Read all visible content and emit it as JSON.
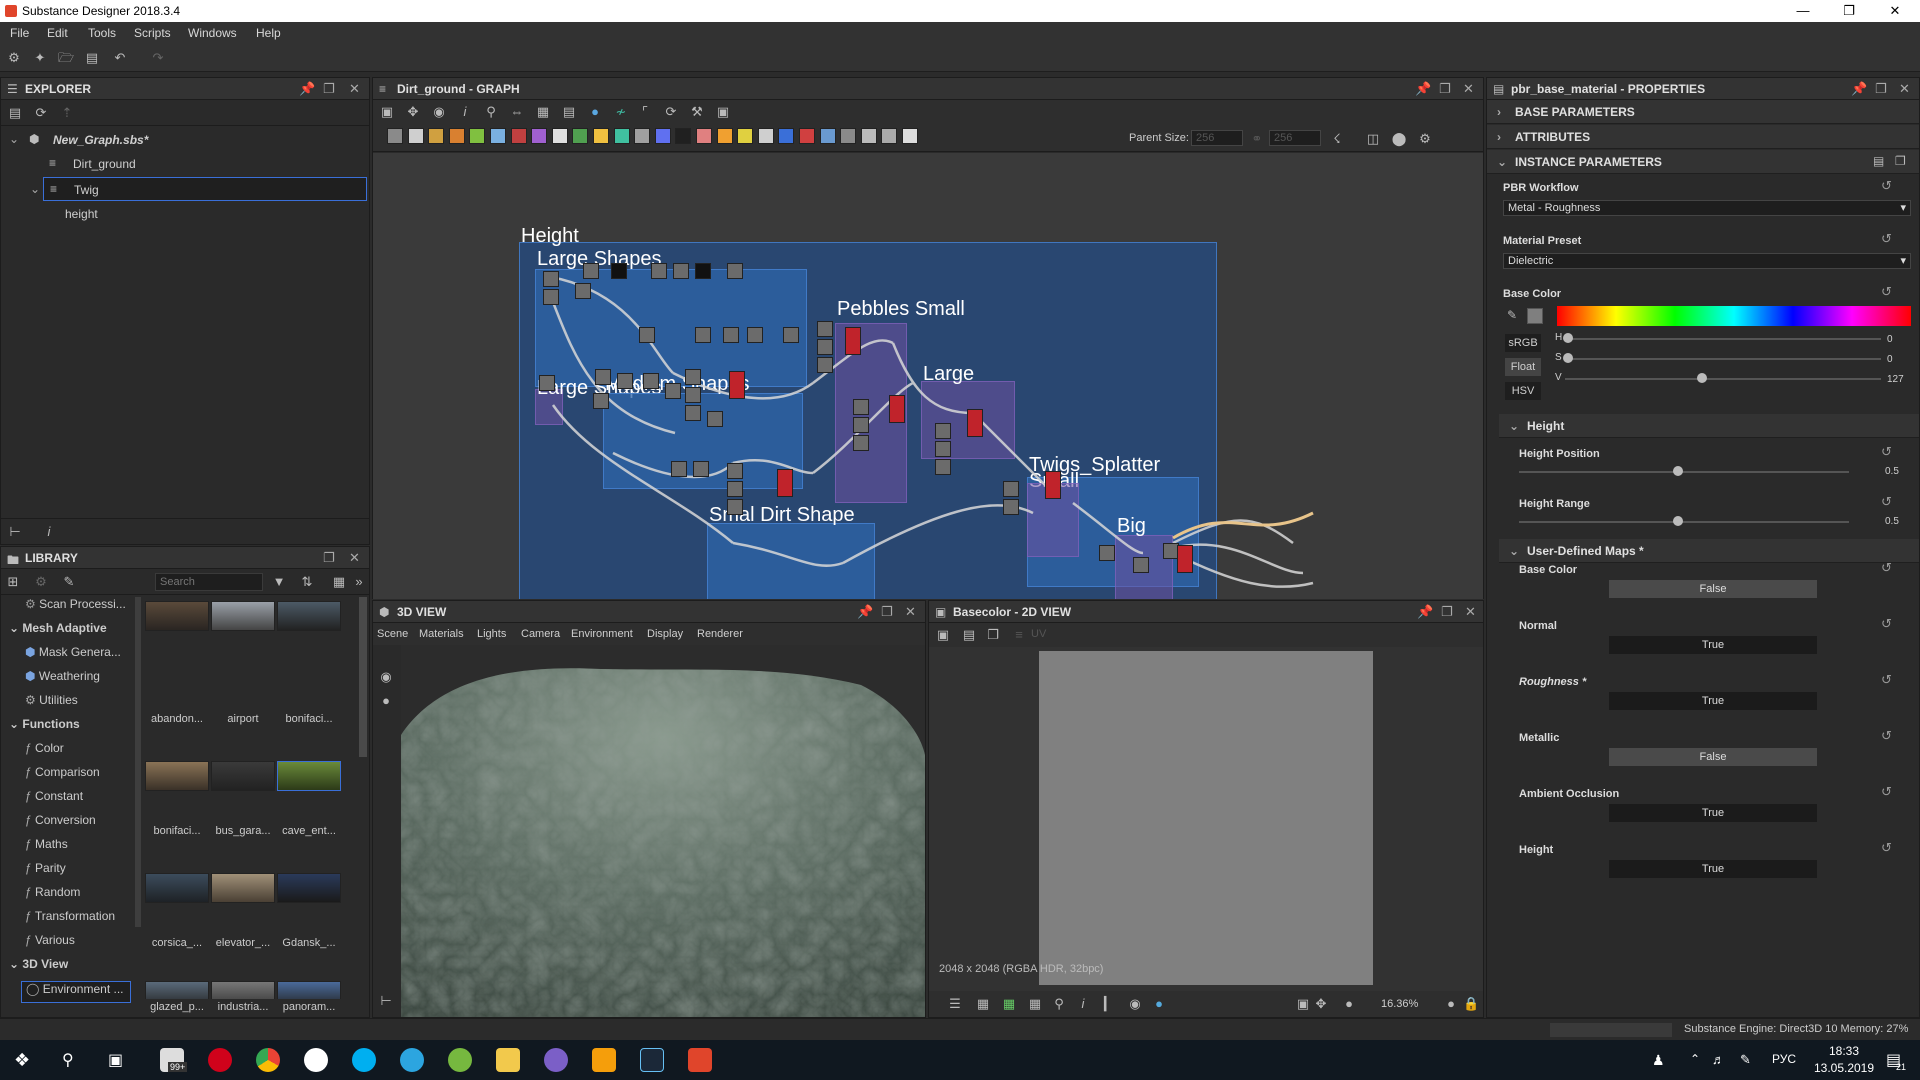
{
  "window": {
    "title": "Substance Designer 2018.3.4"
  },
  "menu": [
    "File",
    "Edit",
    "Tools",
    "Scripts",
    "Windows",
    "Help"
  ],
  "explorer": {
    "title": "EXPLORER",
    "package": "New_Graph.sbs*",
    "items": [
      "Dirt_ground",
      "Twig",
      "height"
    ]
  },
  "library": {
    "title": "LIBRARY",
    "search_placeholder": "Search",
    "categories": [
      "Scan Processi...",
      "Mesh Adaptive",
      "Mask Genera...",
      "Weathering",
      "Utilities",
      "Functions",
      "Color",
      "Comparison",
      "Constant",
      "Conversion",
      "Maths",
      "Parity",
      "Random",
      "Transformation",
      "Various",
      "3D View",
      "Environment ..."
    ],
    "thumbs": [
      "abandon...",
      "airport",
      "bonifaci...",
      "bonifaci...",
      "bus_gara...",
      "cave_ent...",
      "corsica_...",
      "elevator_...",
      "Gdansk_...",
      "glazed_p...",
      "industria...",
      "panoram..."
    ]
  },
  "graph": {
    "title": "Dirt_ground - GRAPH",
    "parent_size_label": "Parent Size:",
    "parent_size": "256",
    "size2": "256",
    "frames": [
      "Height",
      "Large Shapes",
      "Large Shapes",
      "Medium Shapes",
      "Pebbles Small",
      "Large",
      "Smal Dirt Shape",
      "Twigs_Splatter Small",
      "Big"
    ]
  },
  "view3d": {
    "title": "3D VIEW",
    "menu": [
      "Scene",
      "Materials",
      "Lights",
      "Camera",
      "Environment",
      "Display",
      "Renderer"
    ]
  },
  "view2d": {
    "title": "Basecolor - 2D VIEW",
    "uv": "UV",
    "info": "2048 x 2048 (RGBA HDR, 32bpc)",
    "zoom": "16.36%"
  },
  "properties": {
    "title": "pbr_base_material - PROPERTIES",
    "sections": [
      "BASE PARAMETERS",
      "ATTRIBUTES",
      "INSTANCE PARAMETERS"
    ],
    "pbr_workflow_label": "PBR Workflow",
    "pbr_workflow": "Metal - Roughness",
    "material_preset_label": "Material Preset",
    "material_preset": "Dielectric",
    "base_color_label": "Base Color",
    "color_modes": [
      "sRGB",
      "Float",
      "HSV"
    ],
    "hsv": [
      {
        "k": "H",
        "v": "0"
      },
      {
        "k": "S",
        "v": "0"
      },
      {
        "k": "V",
        "v": "127"
      }
    ],
    "height_group": "Height",
    "height_position_label": "Height Position",
    "height_position": "0.5",
    "height_range_label": "Height Range",
    "height_range": "0.5",
    "udm_group": "User-Defined Maps *",
    "maps": [
      {
        "label": "Base Color",
        "value": "False"
      },
      {
        "label": "Normal",
        "value": "True"
      },
      {
        "label": "Roughness *",
        "value": "True"
      },
      {
        "label": "Metallic",
        "value": "False"
      },
      {
        "label": "Ambient Occlusion",
        "value": "True"
      },
      {
        "label": "Height",
        "value": "True"
      }
    ]
  },
  "status": {
    "engine": "Substance Engine: Direct3D 10  Memory: 27%"
  },
  "taskbar": {
    "lang": "РУС",
    "time": "18:33",
    "date": "13.05.2019",
    "badge": "99+",
    "notif": "21"
  }
}
